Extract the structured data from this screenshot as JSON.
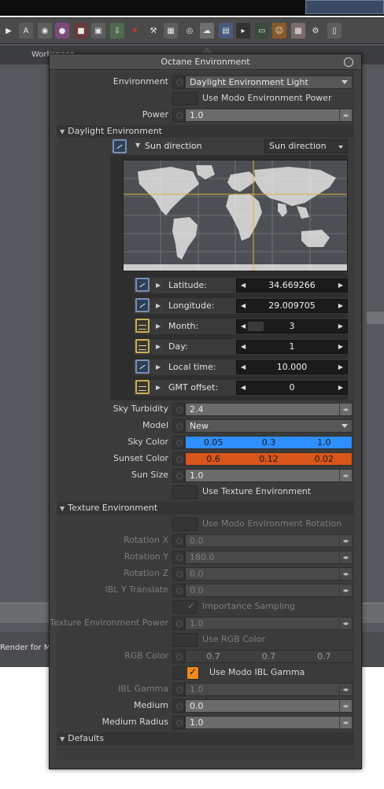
{
  "background": {
    "workspace_label": "Workspace",
    "strip_label": "Render for Mo",
    "ruler_tick": "4"
  },
  "window": {
    "title": "Octane Environment"
  },
  "environment": {
    "label": "Environment",
    "value": "Daylight Environment Light",
    "use_modo_power_label": "Use Modo Environment Power",
    "power_label": "Power",
    "power_value": "1.0"
  },
  "daylight": {
    "section_label": "Daylight Environment",
    "sun_direction_label": "Sun direction",
    "sun_direction_mode": "Sun direction",
    "params": [
      {
        "label": "Latitude:",
        "value": "34.669266",
        "fill": 0.0
      },
      {
        "label": "Longitude:",
        "value": "29.009705",
        "fill": 0.0
      },
      {
        "label": "Month:",
        "value": "3",
        "fill": 0.18
      },
      {
        "label": "Day:",
        "value": "1",
        "fill": 0.0
      },
      {
        "label": "Local time:",
        "value": "10.000",
        "fill": 0.0
      },
      {
        "label": "GMT offset:",
        "value": "0",
        "fill": 0.0
      }
    ],
    "sky_turbidity_label": "Sky Turbidity",
    "sky_turbidity_value": "2.4",
    "model_label": "Model",
    "model_value": "New",
    "sky_color_label": "Sky Color",
    "sky_color_values": [
      "0.05",
      "0.3",
      "1.0"
    ],
    "sky_color_hex": "#2f8fff",
    "sunset_color_label": "Sunset Color",
    "sunset_color_values": [
      "0.6",
      "0.12",
      "0.02"
    ],
    "sunset_color_hex": "#d9561a",
    "sun_size_label": "Sun Size",
    "sun_size_value": "1.0",
    "use_texture_env_label": "Use Texture Environment"
  },
  "texture": {
    "section_label": "Texture Environment",
    "use_modo_rotation_label": "Use Modo Environment Rotation",
    "rotation_x_label": "Rotation X",
    "rotation_x_value": "0.0",
    "rotation_y_label": "Rotation Y",
    "rotation_y_value": "180.0",
    "rotation_z_label": "Rotation Z",
    "rotation_z_value": "0.0",
    "ibl_y_translate_label": "IBL Y Translate",
    "ibl_y_translate_value": "0.0",
    "importance_sampling_label": "Importance Sampling",
    "texture_env_power_label": "Texture Environment Power",
    "texture_env_power_value": "1.0",
    "use_rgb_color_label": "Use RGB Color",
    "rgb_color_label": "RGB Color",
    "rgb_color_values": [
      "0.7",
      "0.7",
      "0.7"
    ],
    "use_modo_ibl_gamma_label": "Use Modo IBL Gamma",
    "ibl_gamma_label": "IBL Gamma",
    "ibl_gamma_value": "1.0",
    "medium_label": "Medium",
    "medium_value": "0.0",
    "medium_radius_label": "Medium Radius",
    "medium_radius_value": "1.0"
  },
  "defaults": {
    "section_label": "Defaults"
  }
}
